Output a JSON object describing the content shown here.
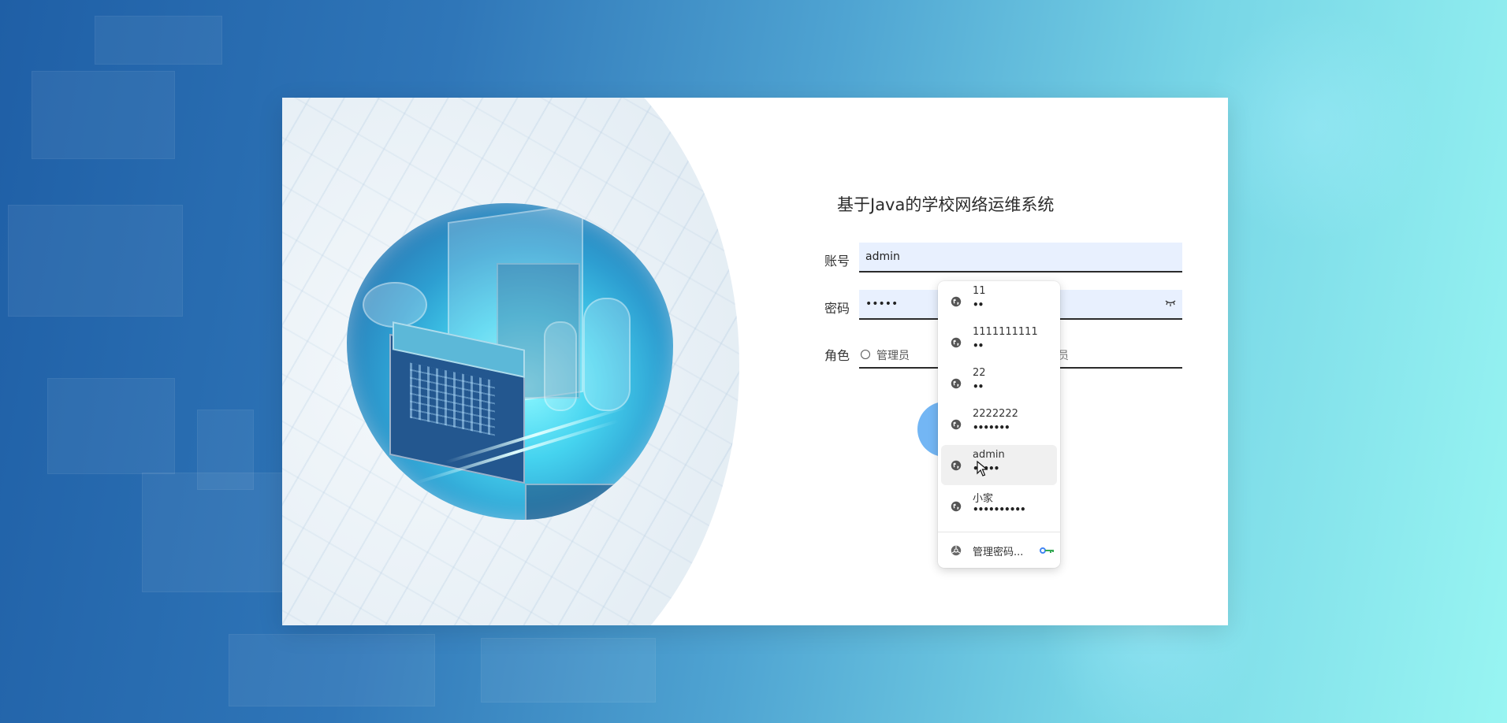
{
  "login": {
    "title": "基于Java的学校网络运维系统",
    "account_label": "账号",
    "account_value": "admin",
    "password_label": "密码",
    "password_value": "•••••",
    "role_label": "角色",
    "role_option_1": "管理员",
    "role_option_2_partial": "员"
  },
  "autofill": {
    "items": [
      {
        "username": "11",
        "password": "••"
      },
      {
        "username": "1111111111",
        "password": "••"
      },
      {
        "username": "22",
        "password": "••"
      },
      {
        "username": "2222222",
        "password": "•••••••"
      },
      {
        "username": "admin",
        "password": "•••••"
      },
      {
        "username": "小家",
        "password": "••••••••••"
      }
    ],
    "footer_label": "管理密码..."
  }
}
